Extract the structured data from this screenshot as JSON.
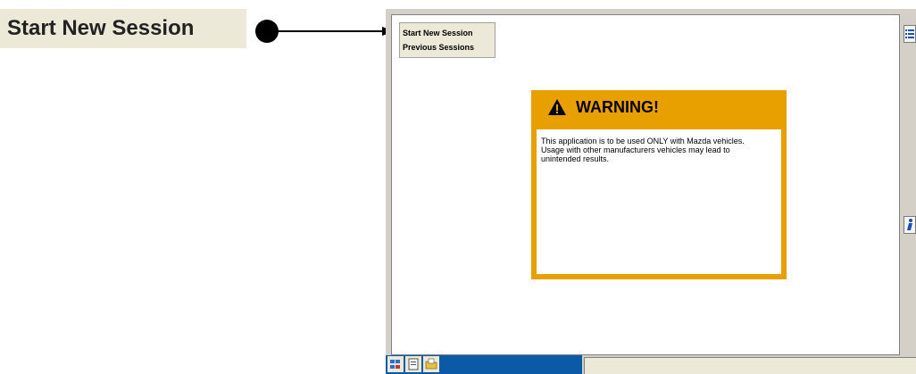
{
  "callout": {
    "label": "Start New Session"
  },
  "menu": {
    "items": [
      "Start New Session",
      "Previous Sessions"
    ]
  },
  "warning": {
    "title": "WARNING!",
    "line1": "This application is to be used ONLY with Mazda vehicles.",
    "line2": "Usage with other manufacturers vehicles may lead to",
    "line3": "unintended results."
  },
  "toolbar": {
    "icons": [
      "list-icon",
      "info-icon"
    ]
  },
  "taskbar": {
    "icons": [
      "vehicle-diagnostics-icon",
      "document-icon",
      "folder-icon"
    ],
    "status_text": ""
  },
  "colors": {
    "warning_accent": "#e8a000",
    "taskbar_blue": "#0a5aa8",
    "menu_bg": "#ece9d8",
    "window_bg": "#d4d0c8"
  }
}
